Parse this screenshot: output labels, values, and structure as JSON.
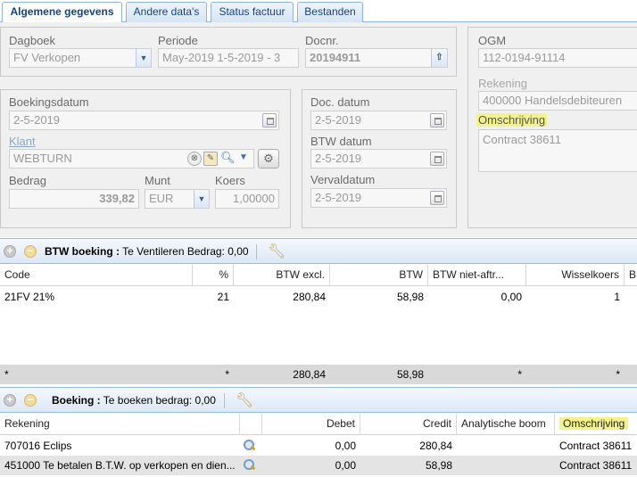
{
  "tabs": [
    {
      "label": "Algemene gegevens",
      "active": true
    },
    {
      "label": "Andere data's",
      "active": false
    },
    {
      "label": "Status factuur",
      "active": false
    },
    {
      "label": "Bestanden",
      "active": false
    }
  ],
  "form": {
    "dagboek": {
      "label": "Dagboek",
      "value": "FV Verkopen"
    },
    "periode": {
      "label": "Periode",
      "value": "May-2019 1-5-2019 - 3"
    },
    "docnr": {
      "label": "Docnr.",
      "value": "20194911"
    },
    "ogm": {
      "label": "OGM",
      "value": "112-0194-91114"
    },
    "rekening": {
      "label": "Rekening",
      "value": "400000 Handelsdebiteuren"
    },
    "omschrijving": {
      "label": "Omschrijving",
      "value": "Contract 38611"
    },
    "boekingsdatum": {
      "label": "Boekingsdatum",
      "value": "2-5-2019"
    },
    "klant": {
      "label": "Klant",
      "value": "WEBTURN"
    },
    "bedrag": {
      "label": "Bedrag",
      "value": "339,82"
    },
    "munt": {
      "label": "Munt",
      "value": "EUR"
    },
    "koers": {
      "label": "Koers",
      "value": "1,00000"
    },
    "doc_datum": {
      "label": "Doc. datum",
      "value": "2-5-2019"
    },
    "btw_datum": {
      "label": "BTW datum",
      "value": "2-5-2019"
    },
    "vervaldatum": {
      "label": "Vervaldatum",
      "value": "2-5-2019"
    }
  },
  "btw_panel": {
    "title": "BTW boeking :",
    "subtitle": "Te Ventileren Bedrag: 0,00",
    "columns": [
      "Code",
      "%",
      "BTW excl.",
      "BTW",
      "BTW niet-aftr...",
      "Wisselkoers",
      "B"
    ],
    "rows": [
      [
        "21FV 21%",
        "21",
        "280,84",
        "58,98",
        "0,00",
        "1"
      ]
    ],
    "summary": [
      "*",
      "*",
      "280,84",
      "58,98",
      "*",
      "*"
    ]
  },
  "boeking_panel": {
    "title": "Boeking :",
    "subtitle": "Te boeken bedrag: 0,00",
    "columns": [
      "Rekening",
      "Debet",
      "Credit",
      "Analytische boom",
      "Omschrijving"
    ],
    "rows": [
      [
        "707016 Eclips",
        "0,00",
        "280,84",
        "",
        "Contract 38611"
      ],
      [
        "451000 Te betalen B.T.W. op verkopen en dien...",
        "0,00",
        "58,98",
        "",
        "Contract 38611"
      ]
    ]
  },
  "colors": {
    "accent": "#15428b",
    "highlight": "#f3f38a",
    "panel_border": "#99bbe8"
  }
}
